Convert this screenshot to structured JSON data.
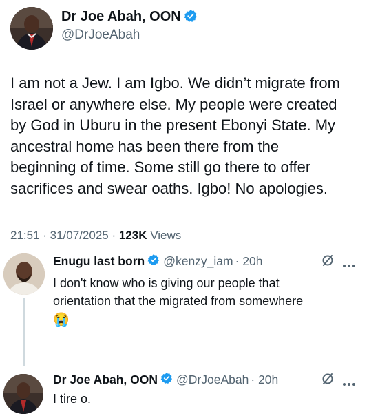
{
  "main_tweet": {
    "author_name": "Dr Joe Abah, OON",
    "handle": "@DrJoeAbah",
    "text_lines": [
      "I am not a Jew. I am Igbo. We didn’t migrate from",
      "Israel or anywhere else. My people were created",
      "by God in Uburu in the present Ebonyi State. My",
      "ancestral home has been there from the",
      "beginning of time. Some still go there to offer",
      "sacrifices and swear oaths. Igbo! No apologies."
    ],
    "timestamp": "21:51 · 31/07/2025 · ",
    "views_count": "123K",
    "views_label": " Views"
  },
  "replies": [
    {
      "author_name": "Enugu last born",
      "handle": "@kenzy_iam",
      "time": "· 20h",
      "text_lines": [
        "I don't know who is giving our people that",
        "orientation that the migrated from somewhere"
      ],
      "emoji": "😭"
    },
    {
      "author_name": "Dr Joe Abah, OON",
      "handle": "@DrJoeAbah",
      "time": "· 20h",
      "text_lines": [
        "I tire o."
      ]
    }
  ],
  "icons": {
    "verified": "verified-badge-icon",
    "grok": "grok-icon",
    "more": "more-icon"
  },
  "colors": {
    "verified_blue": "#1d9bf0",
    "secondary_text": "#536471",
    "primary_text": "#0f1419"
  }
}
